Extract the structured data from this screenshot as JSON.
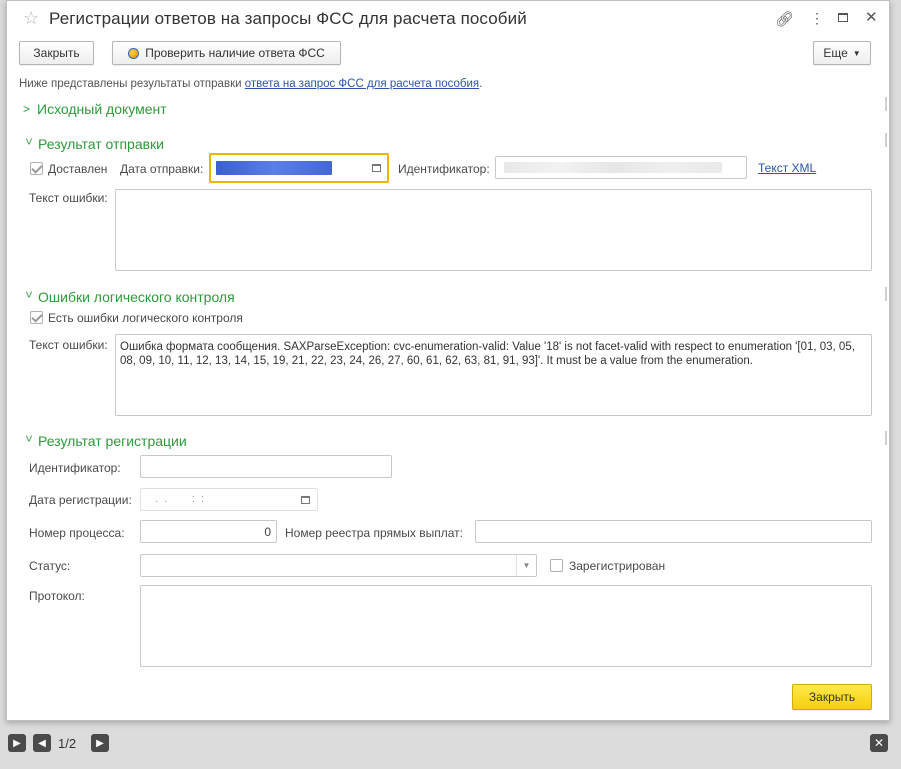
{
  "window": {
    "title": "Регистрации ответов на запросы ФСС для расчета пособий"
  },
  "toolbar": {
    "close_label": "Закрыть",
    "check_label": "Проверить наличие ответа ФСС",
    "more_label": "Еще"
  },
  "info": {
    "prefix": "Ниже представлены результаты отправки ",
    "link": "ответа на запрос ФСС для расчета пособия",
    "suffix": "."
  },
  "source_doc": {
    "header": "Исходный документ"
  },
  "send_result": {
    "header": "Результат отправки",
    "delivered_label": "Доставлен",
    "delivered_checked": true,
    "send_date_label": "Дата отправки:",
    "send_date_value": "",
    "identifier_label": "Идентификатор:",
    "identifier_value": "",
    "xml_link": "Текст XML",
    "error_label": "Текст ошибки:",
    "error_text": ""
  },
  "logic_errors": {
    "header": "Ошибки логического контроля",
    "has_errors_label": "Есть ошибки логического контроля",
    "has_errors_checked": true,
    "error_label": "Текст ошибки:",
    "error_text": "Ошибка формата сообщения. SAXParseException: cvc-enumeration-valid: Value '18' is not facet-valid with respect to enumeration '[01, 03, 05, 08, 09, 10, 11, 12, 13, 14, 15, 19, 21, 22, 23, 24, 26, 27, 60, 61, 62, 63, 81, 91, 93]'. It must be a value from the enumeration."
  },
  "reg_result": {
    "header": "Результат регистрации",
    "identifier_label": "Идентификатор:",
    "identifier_value": "",
    "reg_date_label": "Дата регистрации:",
    "reg_date_value": "  .  .        :  :",
    "process_label": "Номер процесса:",
    "process_value": "0",
    "registry_label": "Номер реестра прямых выплат:",
    "registry_value": "",
    "status_label": "Статус:",
    "status_value": "",
    "registered_label": "Зарегистрирован",
    "registered_checked": false,
    "protocol_label": "Протокол:",
    "protocol_value": ""
  },
  "bottom": {
    "close_label": "Закрыть"
  },
  "footer": {
    "page_indicator": "1/2"
  },
  "colors": {
    "section_green": "#2e9a3a",
    "link_blue": "#2a55a8",
    "focus_border": "#f0b400",
    "button_yellow": "#f5cf0a"
  }
}
